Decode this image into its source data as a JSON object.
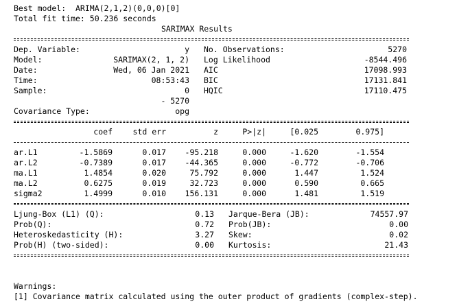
{
  "header": {
    "best_model": "Best model:  ARIMA(2,1,2)(0,0,0)[0]",
    "fit_time": "Total fit time: 50.236 seconds",
    "title": "SARIMAX Results"
  },
  "summary": {
    "left": [
      {
        "label": "Dep. Variable:",
        "value": "y"
      },
      {
        "label": "Model:",
        "value": "SARIMAX(2, 1, 2)"
      },
      {
        "label": "Date:",
        "value": "Wed, 06 Jan 2021"
      },
      {
        "label": "Time:",
        "value": "08:53:43"
      },
      {
        "label": "Sample:",
        "value": "0"
      },
      {
        "label": "",
        "value": "- 5270"
      },
      {
        "label": "Covariance Type:",
        "value": "opg"
      }
    ],
    "right": [
      {
        "label": "No. Observations:",
        "value": "5270"
      },
      {
        "label": "Log Likelihood",
        "value": "-8544.496"
      },
      {
        "label": "AIC",
        "value": "17098.993"
      },
      {
        "label": "BIC",
        "value": "17131.841"
      },
      {
        "label": "HQIC",
        "value": "17110.475"
      }
    ]
  },
  "coef_table": {
    "headers": [
      "",
      "coef",
      "std err",
      "z",
      "P>|z|",
      "[0.025",
      "0.975]"
    ],
    "rows": [
      [
        "ar.L1",
        "-1.5869",
        "0.017",
        "-95.218",
        "0.000",
        "-1.620",
        "-1.554"
      ],
      [
        "ar.L2",
        "-0.7389",
        "0.017",
        "-44.365",
        "0.000",
        "-0.772",
        "-0.706"
      ],
      [
        "ma.L1",
        "1.4854",
        "0.020",
        "75.792",
        "0.000",
        "1.447",
        "1.524"
      ],
      [
        "ma.L2",
        "0.6275",
        "0.019",
        "32.723",
        "0.000",
        "0.590",
        "0.665"
      ],
      [
        "sigma2",
        "1.4999",
        "0.010",
        "156.131",
        "0.000",
        "1.481",
        "1.519"
      ]
    ]
  },
  "diagnostics": [
    {
      "l_label": "Ljung-Box (L1) (Q):",
      "l_value": "0.13",
      "r_label": "Jarque-Bera (JB):",
      "r_value": "74557.97"
    },
    {
      "l_label": "Prob(Q):",
      "l_value": "0.72",
      "r_label": "Prob(JB):",
      "r_value": "0.00"
    },
    {
      "l_label": "Heteroskedasticity (H):",
      "l_value": "3.27",
      "r_label": "Skew:",
      "r_value": "0.02"
    },
    {
      "l_label": "Prob(H) (two-sided):",
      "l_value": "0.00",
      "r_label": "Kurtosis:",
      "r_value": "21.43"
    }
  ],
  "warnings": {
    "title": "Warnings:",
    "items": [
      "[1] Covariance matrix calculated using the outer product of gradients (complex-step)."
    ]
  }
}
